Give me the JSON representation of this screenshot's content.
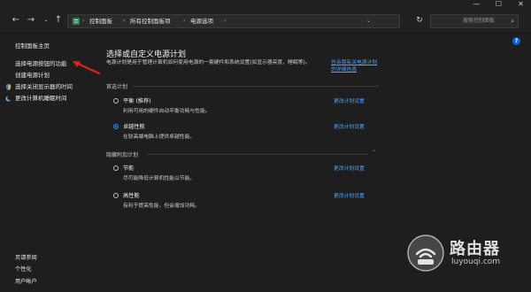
{
  "window": {
    "caption_buttons": {
      "minimize": "—",
      "maximize": "☐",
      "close": "✕"
    }
  },
  "nav": {
    "back": "←",
    "forward": "→",
    "dropdown": "⌄",
    "up": "↑",
    "refresh": "↻",
    "breadcrumb": [
      "控制面板",
      "所有控制面板项",
      "电源选项"
    ],
    "breadcrumb_separator": "›",
    "address_dropdown": "⌄",
    "search_placeholder": "搜索控制面板",
    "search_icon_glyph": "⌕"
  },
  "sidebar": {
    "items": [
      {
        "label": "控制面板主页",
        "icon": ""
      },
      {
        "label": "选择电源按钮的功能",
        "icon": ""
      },
      {
        "label": "创建电源计划",
        "icon": ""
      },
      {
        "label": "选择关闭显示器的时间",
        "icon": "shield-icon"
      },
      {
        "label": "更改计算机睡眠时间",
        "icon": "moon-icon"
      }
    ],
    "see_also_title": "另请参阅",
    "see_also": [
      "个性化",
      "用户帐户"
    ]
  },
  "help": {
    "glyph": "?"
  },
  "main": {
    "heading": "选择或自定义电源计划",
    "intro": "电源计划是用于管理计算机如何使用电源的一套硬件和系统设置(如显示器亮度、睡眠等)。",
    "intro_link": "告诉我有关电源计划的详细信息",
    "preferred_label": "首选计划",
    "hidden_label": "隐藏附加计划",
    "collapse_glyph": "⌃",
    "preferred_plans": [
      {
        "name": "平衡 (推荐)",
        "desc": "利用可用的硬件自动平衡功耗与性能。",
        "link": "更改计划设置",
        "selected": false
      },
      {
        "name": "卓越性能",
        "desc": "在较高端电脑上提供卓越性能。",
        "link": "更改计划设置",
        "selected": true
      }
    ],
    "hidden_plans": [
      {
        "name": "节能",
        "desc": "尽可能降低计算机性能以节能。",
        "link": "更改计划设置",
        "selected": false
      },
      {
        "name": "高性能",
        "desc": "有利于提高性能，但会增加功耗。",
        "link": "更改计划设置",
        "selected": false
      }
    ]
  },
  "watermark": {
    "name": "路由器",
    "url": "luyouqi.com"
  },
  "colors": {
    "background": "#1e1e1e",
    "link": "#4ea1ff",
    "accent": "#0a64d8",
    "annotation_arrow": "#e02020"
  }
}
